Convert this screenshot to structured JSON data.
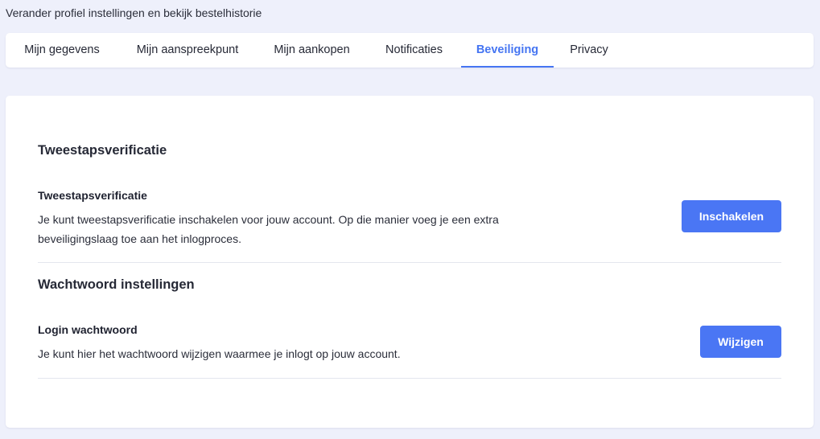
{
  "header": {
    "subtitle": "Verander profiel instellingen en bekijk bestelhistorie"
  },
  "tabs": [
    {
      "label": "Mijn gegevens",
      "active": false
    },
    {
      "label": "Mijn aanspreekpunt",
      "active": false
    },
    {
      "label": "Mijn aankopen",
      "active": false
    },
    {
      "label": "Notificaties",
      "active": false
    },
    {
      "label": "Beveiliging",
      "active": true
    },
    {
      "label": "Privacy",
      "active": false
    }
  ],
  "security": {
    "two_factor_section": {
      "title": "Tweestapsverificatie",
      "item_title": "Tweestapsverificatie",
      "description": "Je kunt tweestapsverificatie inschakelen voor jouw account. Op die manier voeg je een extra beveiligingslaag toe aan het inlogproces.",
      "button_label": "Inschakelen"
    },
    "password_section": {
      "title": "Wachtwoord instellingen",
      "item_title": "Login wachtwoord",
      "description": "Je kunt hier het wachtwoord wijzigen waarmee je inlogt op jouw account.",
      "button_label": "Wijzigen"
    }
  },
  "colors": {
    "accent": "#4575f2",
    "background": "#eef0fb",
    "card": "#ffffff"
  }
}
